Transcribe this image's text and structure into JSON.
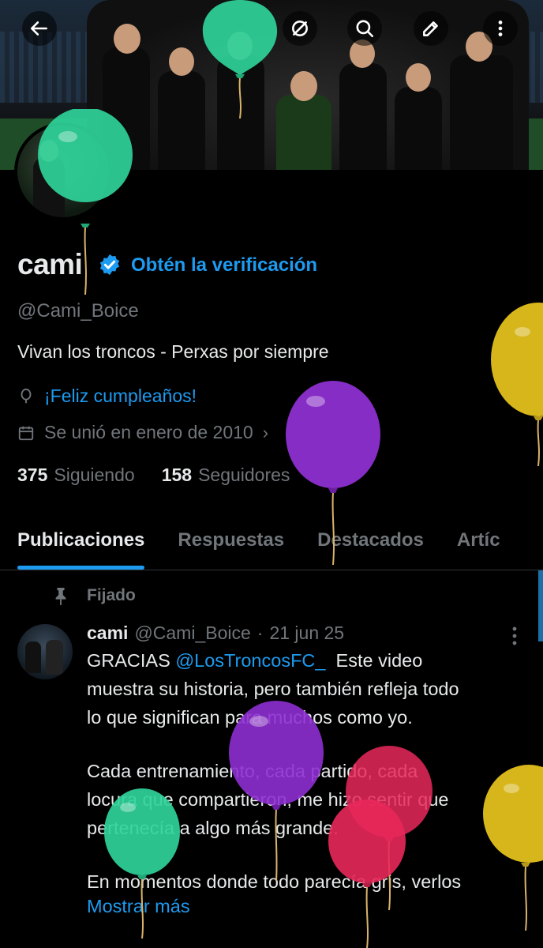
{
  "profile": {
    "name": "cami",
    "get_verified": "Obtén la verificación",
    "handle": "@Cami_Boice",
    "bio": "Vivan los troncos - Perxas por siempre",
    "birthday": "¡Feliz cumpleaños!",
    "joined": "Se unió en enero de 2010",
    "following_count": "375",
    "following_label": "Siguiendo",
    "followers_count": "158",
    "followers_label": "Seguidores"
  },
  "tabs": [
    {
      "label": "Publicaciones",
      "active": true
    },
    {
      "label": "Respuestas"
    },
    {
      "label": "Destacados"
    },
    {
      "label": "Artíc"
    }
  ],
  "post": {
    "pinned_label": "Fijado",
    "author": "cami",
    "handle": "@Cami_Boice",
    "separator": "·",
    "date": "21 jun 25",
    "line1_prefix": "GRACIAS ",
    "mention": "@LosTroncosFC_",
    "line1_suffix": "  Este video",
    "line2": "muestra su historia, pero también refleja todo",
    "line3": "lo que significan para muchos como yo.",
    "line4": "Cada entrenamiento, cada partido, cada",
    "line5": "locura que compartieron, me hizo sentir que",
    "line6": "pertenecía a algo más grande.",
    "line7": "En momentos donde todo parecía gris, verlos",
    "show_more": "Mostrar más"
  },
  "colors": {
    "accent": "#1d9bf0",
    "muted": "#71767b",
    "balloon_green": "#2fd39a",
    "balloon_purple": "#8d2fd0",
    "balloon_yellow": "#e3c01e",
    "balloon_red": "#e8285a"
  },
  "icons": [
    "back-arrow-icon",
    "hide-icon",
    "search-icon",
    "edit-icon",
    "more-vertical-icon",
    "verified-icon",
    "balloon-icon",
    "calendar-icon",
    "pin-icon"
  ]
}
